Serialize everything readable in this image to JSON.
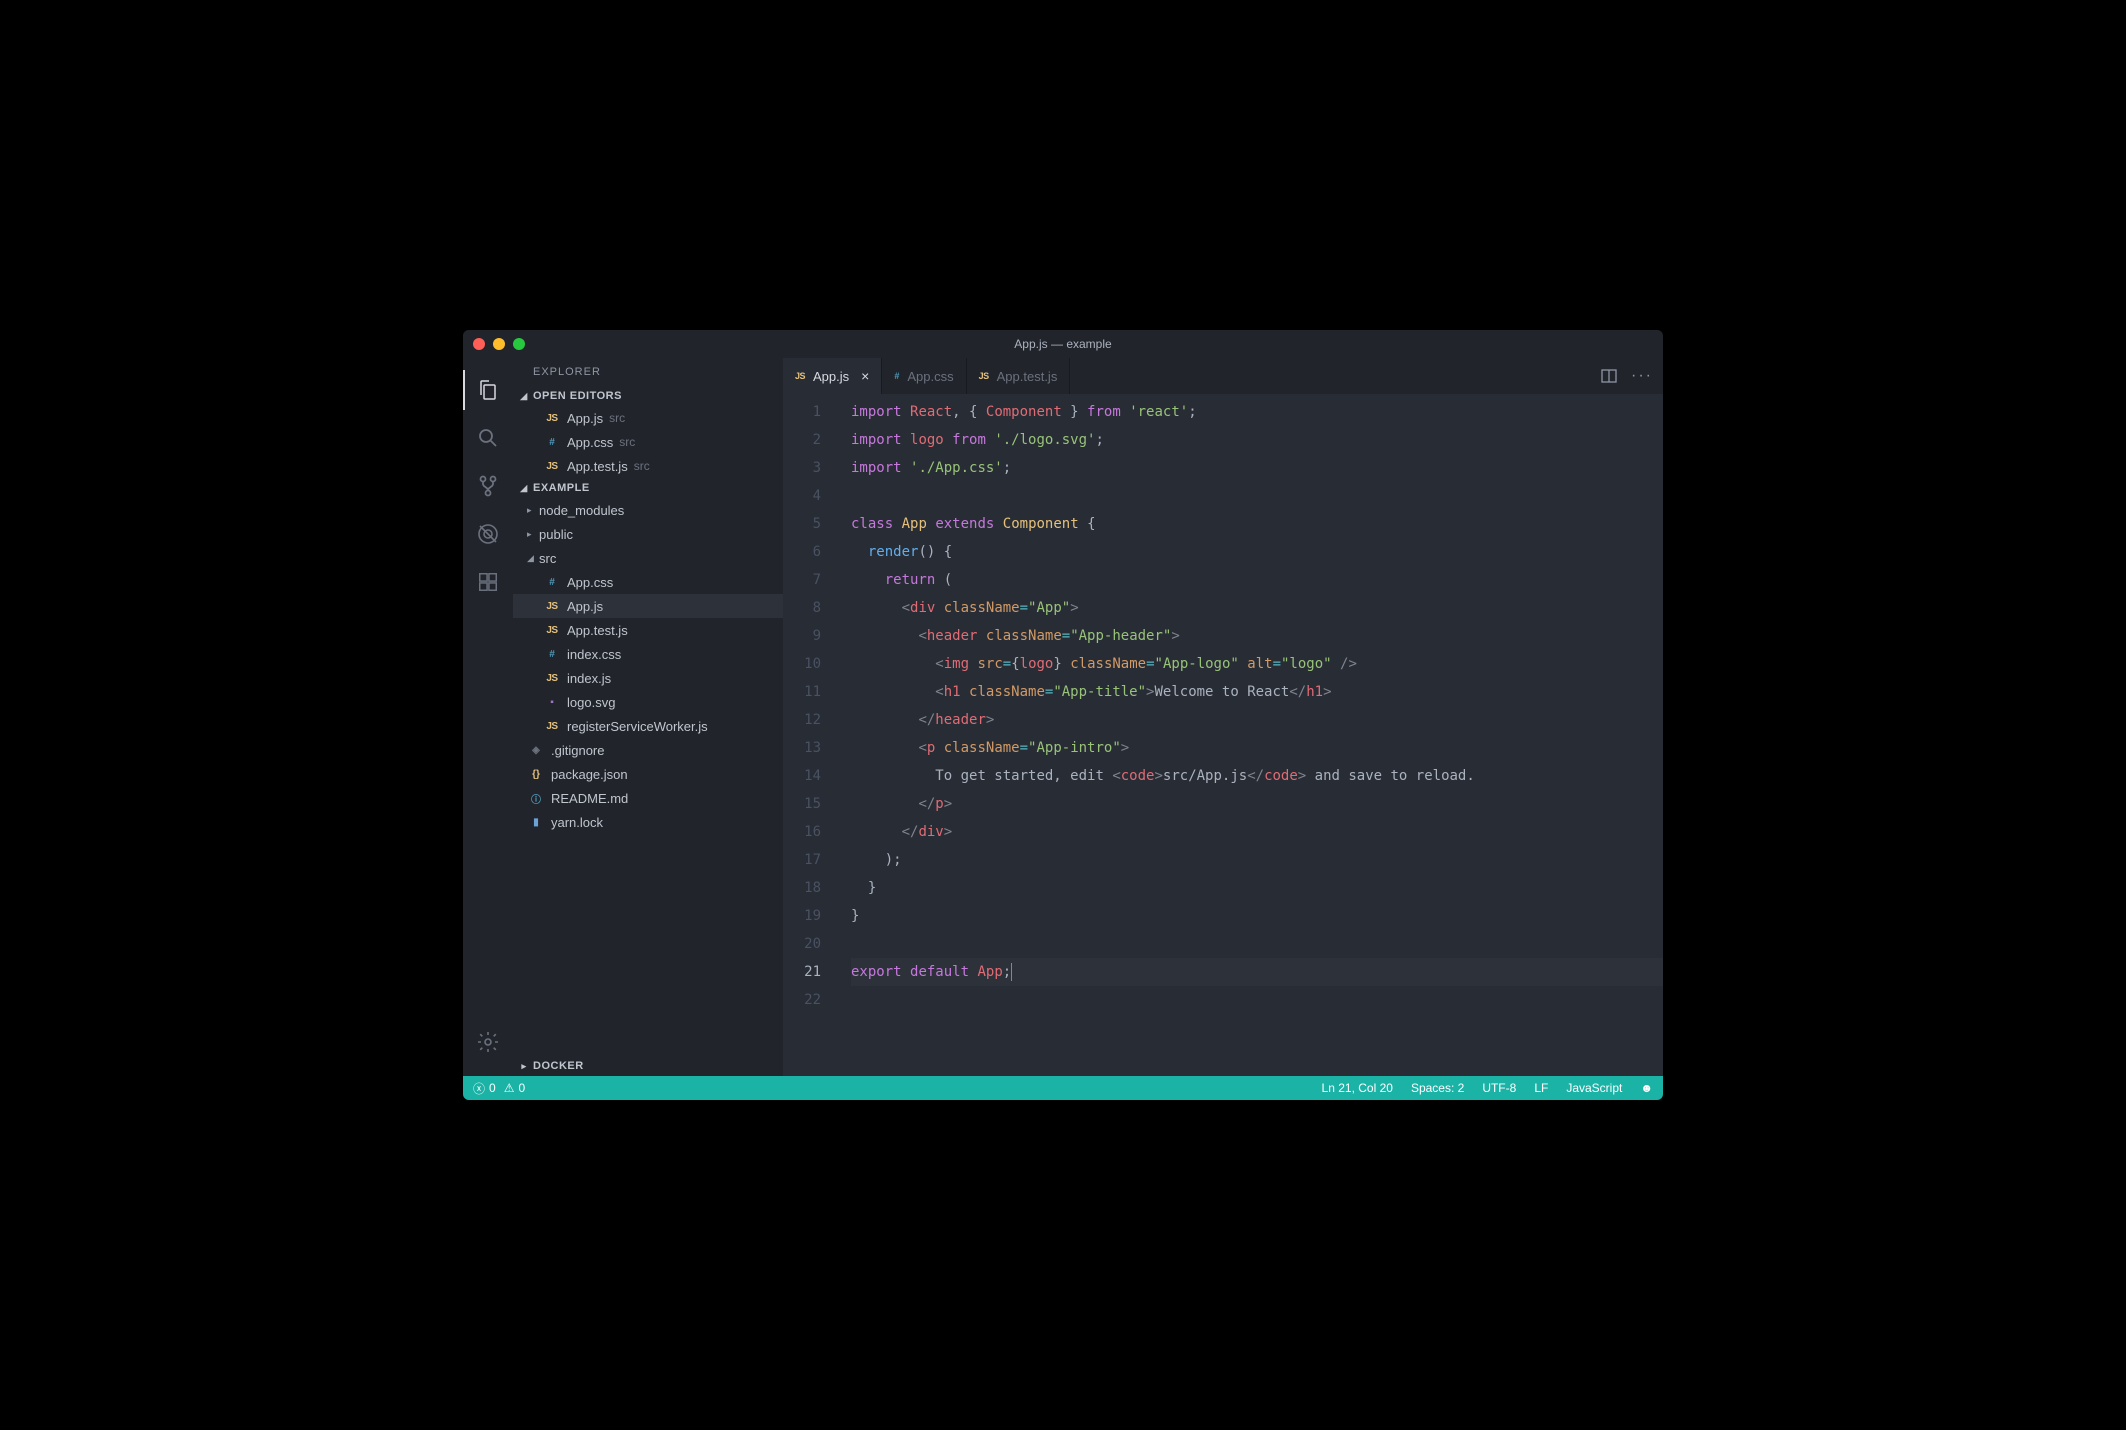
{
  "window_title": "App.js — example",
  "sidebar": {
    "title": "EXPLORER",
    "open_editors_label": "OPEN EDITORS",
    "project_label": "EXAMPLE",
    "docker_label": "DOCKER",
    "open_editors": [
      {
        "icon": "JS",
        "name": "App.js",
        "dir": "src"
      },
      {
        "icon": "#",
        "name": "App.css",
        "dir": "src"
      },
      {
        "icon": "JS",
        "name": "App.test.js",
        "dir": "src"
      }
    ],
    "tree": {
      "node_modules": "node_modules",
      "public": "public",
      "src": "src",
      "files": {
        "app_css": "App.css",
        "app_js": "App.js",
        "app_test": "App.test.js",
        "index_css": "index.css",
        "index_js": "index.js",
        "logo_svg": "logo.svg",
        "register_sw": "registerServiceWorker.js"
      },
      "gitignore": ".gitignore",
      "package_json": "package.json",
      "readme": "README.md",
      "yarn_lock": "yarn.lock"
    }
  },
  "tabs": [
    {
      "icon": "JS",
      "label": "App.js",
      "active": true,
      "closeable": true
    },
    {
      "icon": "#",
      "label": "App.css"
    },
    {
      "icon": "JS",
      "label": "App.test.js"
    }
  ],
  "code_lines": 22,
  "status": {
    "errors": "0",
    "warnings": "0",
    "cursor": "Ln 21, Col 20",
    "spaces": "Spaces: 2",
    "encoding": "UTF-8",
    "eol": "LF",
    "lang": "JavaScript"
  },
  "code_content": {
    "file": "App.js",
    "imports": [
      "React",
      "Component",
      "logo",
      "./logo.svg",
      "./App.css",
      "react"
    ],
    "class_name": "App",
    "extends": "Component",
    "method": "render",
    "jsx_classes": [
      "App",
      "App-header",
      "App-logo",
      "App-title",
      "App-intro"
    ],
    "h1_text": "Welcome to React",
    "p_text_prefix": "To get started, edit ",
    "p_code": "src/App.js",
    "p_text_suffix": " and save to reload.",
    "alt": "logo",
    "export": "App"
  }
}
